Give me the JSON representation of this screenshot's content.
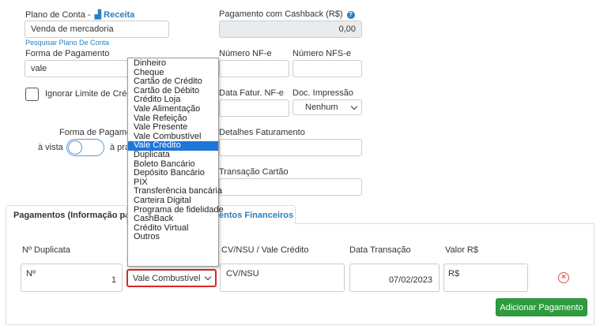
{
  "plano_conta": {
    "label": "Plano de Conta -",
    "receita_label": "Receita",
    "value": "Venda de mercadoria",
    "search_link": "Pesquisar Plano De Conta"
  },
  "cashback": {
    "label": "Pagamento com Cashback (R$)",
    "value": "0,00"
  },
  "forma_pagamento": {
    "label": "Forma de Pagamento",
    "value": "vale"
  },
  "nf": {
    "numero_nfe_label": "Número NF-e",
    "numero_nfse_label": "Número NFS-e"
  },
  "ignorar": {
    "label": "Ignorar Limite de Crédit"
  },
  "fatur": {
    "data_label": "Data Fatur. NF-e",
    "doc_label": "Doc. Impressão",
    "doc_value": "Nenhum"
  },
  "forma_pag_toggle": {
    "label": "Forma de Pagamen",
    "left": "à vista",
    "right": "à pra"
  },
  "detalhes": {
    "label": "Detalhes Faturamento"
  },
  "transacao": {
    "label": "Transação Cartão"
  },
  "tabs": {
    "pagamentos": "Pagamentos (Informação para",
    "financeiros": "entos Financeiros"
  },
  "table": {
    "headers": {
      "duplicata": "Nº Duplicata",
      "cv": "CV/NSU / Vale Crédito",
      "data": "Data Transação",
      "valor": "Valor R$"
    },
    "row": {
      "no_label": "Nº",
      "no_value": "1",
      "forma": "Vale Combustível",
      "cv_placeholder": "CV/NSU",
      "data": "07/02/2023",
      "valor_placeholder": "R$"
    }
  },
  "add_button": "Adicionar Pagamento",
  "dropdown_options": [
    "Dinheiro",
    "Cheque",
    "Cartão de Crédito",
    "Cartão de Débito",
    "Crédito Loja",
    "Vale Alimentação",
    "Vale Refeição",
    "Vale Presente",
    "Vale Combustível",
    "Vale Crédito",
    "Duplicata",
    "Boleto Bancário",
    "Depósito Bancário",
    "PIX",
    "Transferência bancária",
    "Carteira Digital",
    "Programa de fidelidade",
    "CashBack",
    "Crédito Virtual",
    "Outros"
  ],
  "dropdown_selected_index": 9,
  "colors": {
    "link": "#2a7fc0",
    "highlight": "#1e76d8",
    "button": "#2e9b3f",
    "focus_border": "#d9262a",
    "remove": "#d9534f"
  }
}
